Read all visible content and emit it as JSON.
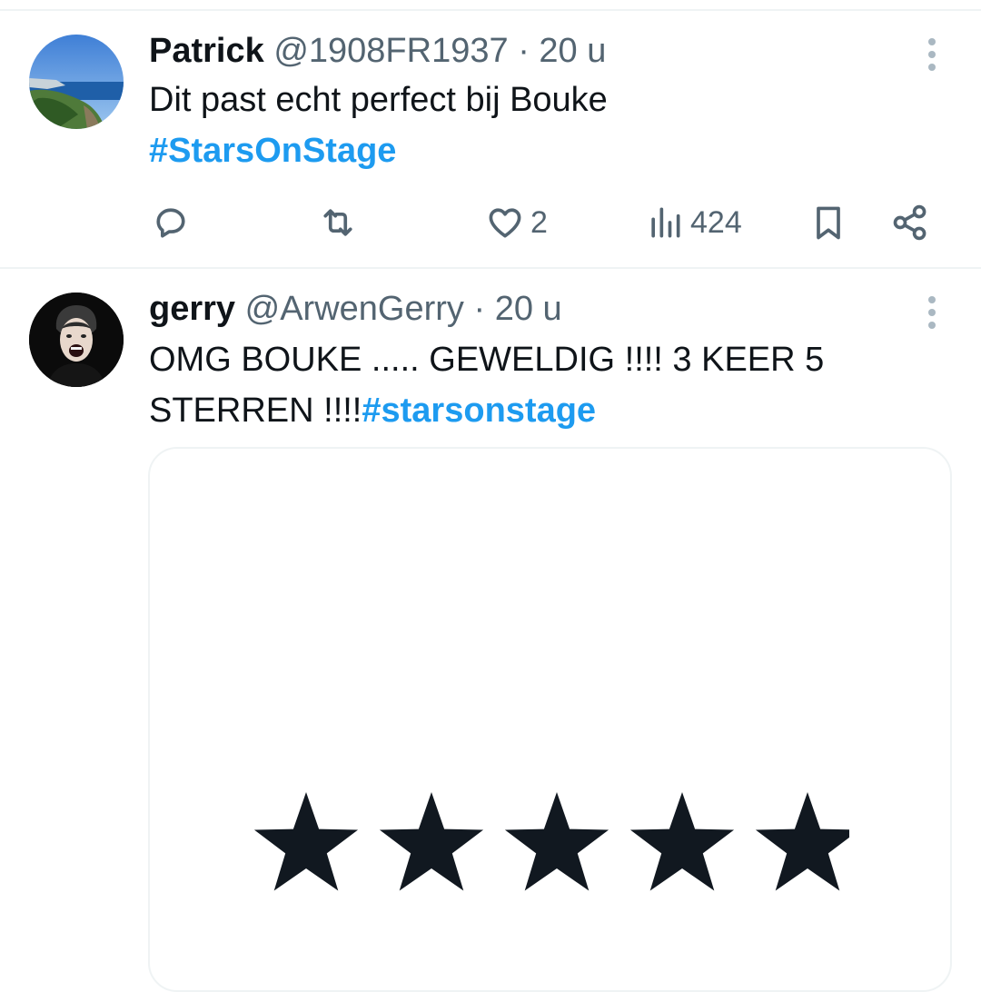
{
  "tweets": [
    {
      "author_name": "Patrick",
      "author_handle": "@1908FR1937",
      "separator": "·",
      "time": "20 u",
      "text": "Dit past echt perfect bij Bouke",
      "hashtag": "#StarsOnStage",
      "actions": {
        "reply_icon": "reply-icon",
        "repost_icon": "repost-icon",
        "like_count": "2",
        "views_count": "424",
        "bookmark_icon": "bookmark-icon",
        "share_icon": "share-icon"
      },
      "avatar": "coastline-photo"
    },
    {
      "author_name": "gerry",
      "author_handle": "@ArwenGerry",
      "separator": "·",
      "time": "20 u",
      "text_line1": "OMG BOUKE ..... GEWELDIG !!!! 3 KEER 5",
      "text_line2": "STERREN !!!!",
      "hashtag": "#starsonstage",
      "avatar": "person-portrait",
      "media": {
        "type": "image",
        "description_icon": "five-stars",
        "star_count": 5,
        "star_color": "#111820"
      }
    }
  ],
  "colors": {
    "hashtag": "#1d9bf0",
    "secondary_text": "#536471",
    "divider": "#eff3f4"
  }
}
